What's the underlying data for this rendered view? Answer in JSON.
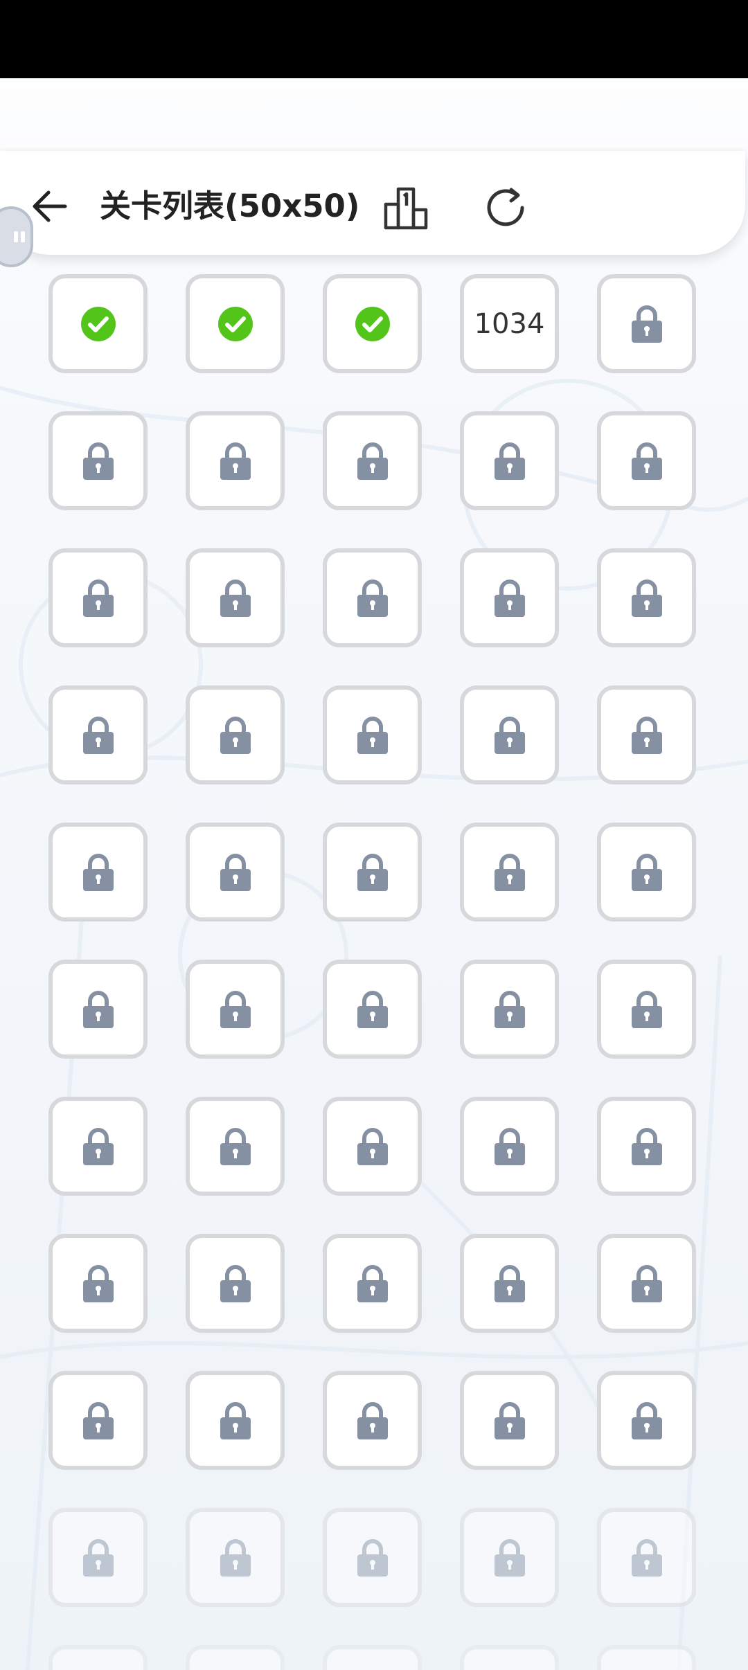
{
  "header": {
    "title": "关卡列表(50x50)",
    "back_icon": "arrow-left-icon",
    "rank_icon": "podium-icon",
    "refresh_icon": "refresh-icon"
  },
  "colors": {
    "completed": "#52c41a",
    "lock": "#8591a3",
    "cell_border": "#d6d8dc",
    "status_bar": "#000000"
  },
  "levels": {
    "columns": 5,
    "row1": [
      {
        "status": "completed",
        "icon": "check-circle-icon"
      },
      {
        "status": "completed",
        "icon": "check-circle-icon"
      },
      {
        "status": "completed",
        "icon": "check-circle-icon"
      },
      {
        "status": "current",
        "label": "1034"
      },
      {
        "status": "locked",
        "icon": "lock-icon"
      }
    ],
    "locked_rows": 8,
    "faded_rows": 1
  }
}
